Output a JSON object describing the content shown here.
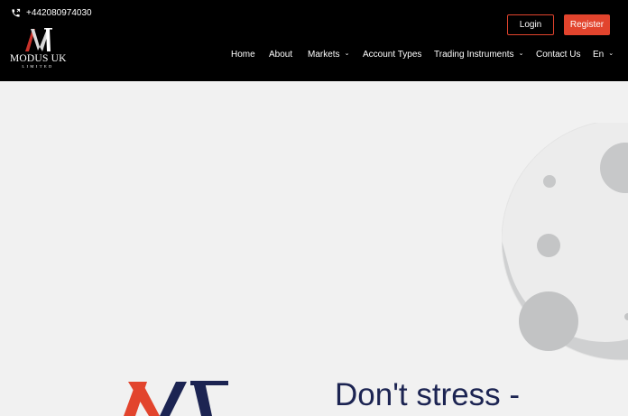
{
  "header": {
    "phone": "+442080974030",
    "logo": {
      "name": "MODUS UK",
      "sub": "LIMITED",
      "mark": "M"
    },
    "login_label": "Login",
    "register_label": "Register"
  },
  "nav": {
    "items": [
      {
        "label": "Home",
        "dropdown": false
      },
      {
        "label": "About",
        "dropdown": false
      },
      {
        "label": "Markets",
        "dropdown": true
      },
      {
        "label": "Account Types",
        "dropdown": false
      },
      {
        "label": "Trading Instruments",
        "dropdown": true
      },
      {
        "label": "Contact Us",
        "dropdown": false
      },
      {
        "label": "En",
        "dropdown": true
      }
    ]
  },
  "hero": {
    "headline": "Don't stress -"
  },
  "colors": {
    "accent": "#e2442d",
    "header_bg": "#000000",
    "page_bg": "#f1f1f1",
    "headline": "#1c2452"
  },
  "icons": [
    "phone-icon",
    "chevron-down-icon",
    "moon-illustration",
    "logo-mark"
  ]
}
